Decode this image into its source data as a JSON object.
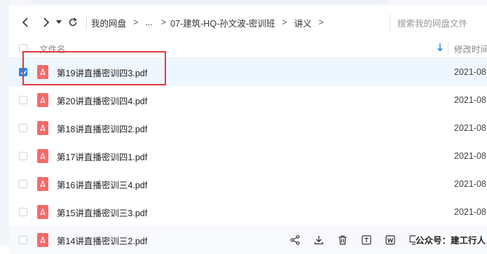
{
  "nav": {
    "breadcrumbs": [
      "我的网盘",
      "...",
      "07-建筑-HQ-孙文波-密训班",
      "讲义"
    ],
    "separator": ">",
    "search_placeholder": "搜索我的网盘文件"
  },
  "table": {
    "col_name": "文件名",
    "col_mtime": "修改时间"
  },
  "files": [
    {
      "name": "第19讲直播密训四3.pdf",
      "date": "2021-08",
      "selected": true
    },
    {
      "name": "第20讲直播密训四4.pdf",
      "date": "2021-08",
      "selected": false
    },
    {
      "name": "第18讲直播密训四2.pdf",
      "date": "2021-08",
      "selected": false
    },
    {
      "name": "第17讲直播密训四1.pdf",
      "date": "2021-08",
      "selected": false
    },
    {
      "name": "第16讲直播密训三4.pdf",
      "date": "2021-08",
      "selected": false
    },
    {
      "name": "第15讲直播密训三3.pdf",
      "date": "2021-08",
      "selected": false
    },
    {
      "name": "第14讲直播密训三2.pdf",
      "date": "",
      "selected": false
    }
  ],
  "watermark": "公众号：建工行人",
  "icons": {
    "back": "chevron-left-icon",
    "forward": "chevron-right-icon",
    "history": "caret-down-icon",
    "refresh": "refresh-icon",
    "sort": "arrow-down-icon",
    "file": "pdf-icon",
    "actions": [
      "share-icon",
      "download-icon",
      "delete-icon",
      "text-icon",
      "word-icon",
      "copy-icon"
    ]
  },
  "colors": {
    "accent": "#1a8bff",
    "selected_row": "#eef6ff",
    "pdf": "#f56a6a",
    "highlight_box": "#e23a3a"
  }
}
